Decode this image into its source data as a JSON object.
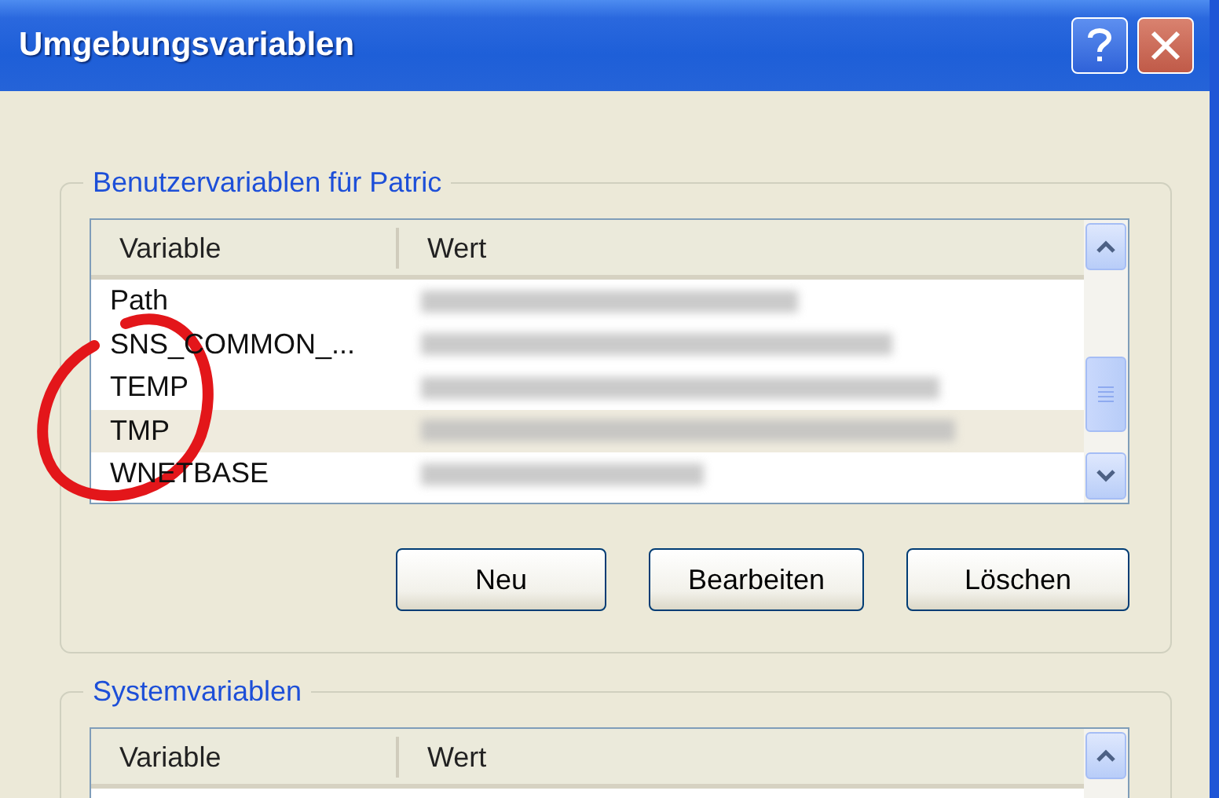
{
  "window": {
    "title": "Umgebungsvariablen"
  },
  "user_variables": {
    "title": "Benutzervariablen für Patric",
    "columns": [
      "Variable",
      "Wert"
    ],
    "rows": [
      {
        "variable": "Path",
        "selected": false
      },
      {
        "variable": "SNS_COMMON_...",
        "selected": false
      },
      {
        "variable": "TEMP",
        "selected": false
      },
      {
        "variable": "TMP",
        "selected": true
      },
      {
        "variable": "WNETBASE",
        "selected": false
      }
    ],
    "buttons": [
      "Neu",
      "Bearbeiten",
      "Löschen"
    ]
  },
  "system_variables": {
    "title": "Systemvariablen",
    "columns": [
      "Variable",
      "Wert"
    ]
  }
}
